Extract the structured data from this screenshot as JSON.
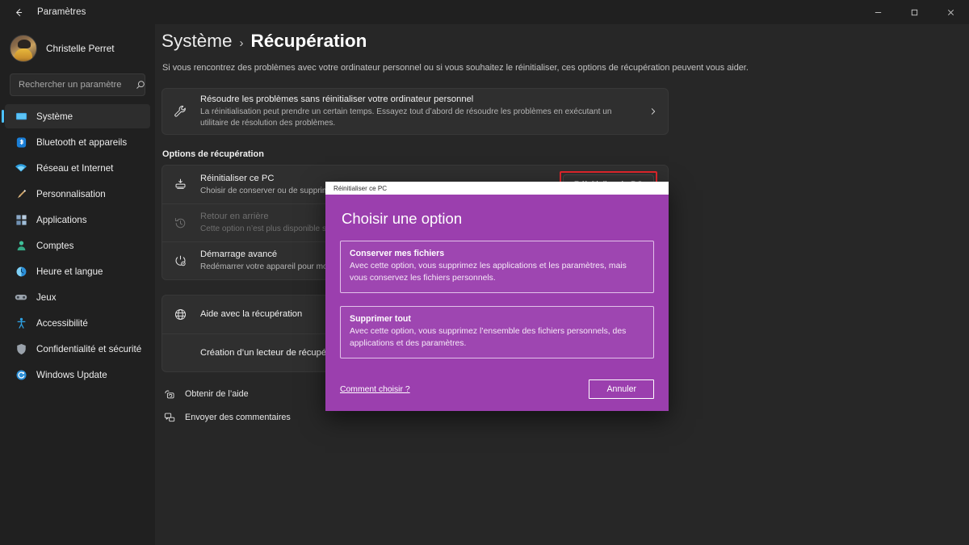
{
  "window": {
    "title": "Paramètres",
    "back_icon": "back-arrow-icon",
    "minimize": "—",
    "maximize": "▢",
    "close": "✕"
  },
  "sidebar": {
    "account": {
      "name": "Christelle Perret",
      "avatar": "user-avatar"
    },
    "search": {
      "placeholder": "Rechercher un paramètre",
      "icon": "search-icon"
    },
    "items": [
      {
        "label": "Système",
        "icon": "monitor-icon",
        "active": true
      },
      {
        "label": "Bluetooth et appareils",
        "icon": "bluetooth-icon",
        "active": false
      },
      {
        "label": "Réseau et Internet",
        "icon": "wifi-icon",
        "active": false
      },
      {
        "label": "Personnalisation",
        "icon": "paintbrush-icon",
        "active": false
      },
      {
        "label": "Applications",
        "icon": "apps-icon",
        "active": false
      },
      {
        "label": "Comptes",
        "icon": "account-icon",
        "active": false
      },
      {
        "label": "Heure et langue",
        "icon": "clock-globe-icon",
        "active": false
      },
      {
        "label": "Jeux",
        "icon": "gamepad-icon",
        "active": false
      },
      {
        "label": "Accessibilité",
        "icon": "accessibility-icon",
        "active": false
      },
      {
        "label": "Confidentialité et sécurité",
        "icon": "shield-icon",
        "active": false
      },
      {
        "label": "Windows Update",
        "icon": "update-icon",
        "active": false
      }
    ]
  },
  "main": {
    "breadcrumb": {
      "parent": "Système",
      "separator": "›",
      "current": "Récupération"
    },
    "intro": "Si vous rencontrez des problèmes avec votre ordinateur personnel ou si vous souhaitez le réinitialiser, ces options de récupération peuvent vous aider.",
    "troubleshoot_card": {
      "icon": "wrench-icon",
      "title": "Résoudre les problèmes sans réinitialiser votre ordinateur personnel",
      "subtitle": "La réinitialisation peut prendre un certain temps. Essayez tout d’abord de résoudre les problèmes en exécutant un utilitaire de résolution des problèmes.",
      "chevron": "›"
    },
    "section_title": "Options de récupération",
    "options": [
      {
        "icon": "reset-pc-icon",
        "title": "Réinitialiser ce PC",
        "subtitle": "Choisir de conserver ou de supprimer vos fichiers personnels, puis réinstaller Windows",
        "action_label": "Réinitialiser le PC",
        "highlighted": true,
        "disabled": false
      },
      {
        "icon": "history-icon",
        "title": "Retour en arrière",
        "subtitle": "Cette option n’est plus disponible sur cet ordina",
        "action_label": "",
        "highlighted": false,
        "disabled": true
      },
      {
        "icon": "advanced-startup-icon",
        "title": "Démarrage avancé",
        "subtitle": "Redémarrer votre appareil pour modifier les par",
        "action_label": "",
        "highlighted": false,
        "disabled": false
      }
    ],
    "help_card": [
      {
        "icon": "globe-icon",
        "title": "Aide avec la récupération",
        "subtitle": ""
      },
      {
        "icon": "",
        "title": "Création d’un lecteur de récupération",
        "subtitle": ""
      }
    ],
    "footer_links": [
      {
        "icon": "get-help-icon",
        "label": "Obtenir de l’aide"
      },
      {
        "icon": "feedback-icon",
        "label": "Envoyer des commentaires"
      }
    ]
  },
  "dialog": {
    "titlebar": "Réinitialiser ce PC",
    "heading": "Choisir une option",
    "options": [
      {
        "title": "Conserver mes fichiers",
        "description": "Avec cette option, vous supprimez les applications et les paramètres, mais vous conservez les fichiers personnels."
      },
      {
        "title": "Supprimer tout",
        "description": "Avec cette option, vous supprimez l’ensemble des fichiers personnels, des applications et des paramètres."
      }
    ],
    "help_link": "Comment choisir ?",
    "cancel_label": "Annuler"
  },
  "colors": {
    "accent": "#4cc2ff",
    "dialog_purple": "#9b3fae",
    "highlight_red": "#e0262b",
    "window_bg": "#202020",
    "content_bg": "#272727",
    "card_bg": "#2f2f2f"
  }
}
